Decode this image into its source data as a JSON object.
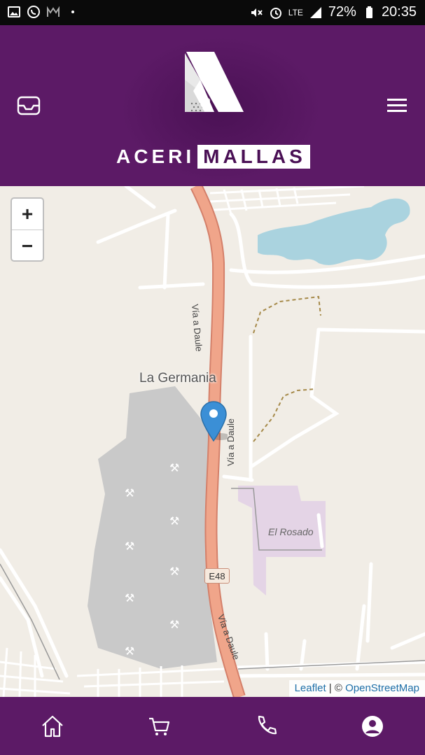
{
  "status_bar": {
    "battery": "72%",
    "time": "20:35",
    "network": "LTE",
    "icons": [
      "image-icon",
      "whatsapp-icon",
      "app-icon",
      "dot-icon",
      "mute-icon",
      "alarm-icon",
      "signal-icon",
      "battery-icon"
    ]
  },
  "header": {
    "logo_text_left": "ACERI",
    "logo_text_right": "MALLAS",
    "left_icon": "inbox-icon",
    "right_icon": "hamburger-menu-icon",
    "bg_color": "#5c1a66"
  },
  "map": {
    "zoom_in_label": "+",
    "zoom_out_label": "−",
    "place_label": "La Germania",
    "poi_label": "El Rosado",
    "road_label_top": "Vía a Daule",
    "road_label_mid": "Vía a Daule",
    "road_label_bottom": "Vía a Daule",
    "road_shield": "E48",
    "attribution": {
      "leaflet": "Leaflet",
      "separator": " | © ",
      "osm": "OpenStreetMap"
    },
    "marker_color": "#3b8fd6"
  },
  "bottom_nav": {
    "items": [
      {
        "icon": "home-icon"
      },
      {
        "icon": "cart-icon"
      },
      {
        "icon": "phone-icon"
      },
      {
        "icon": "account-icon"
      }
    ]
  }
}
